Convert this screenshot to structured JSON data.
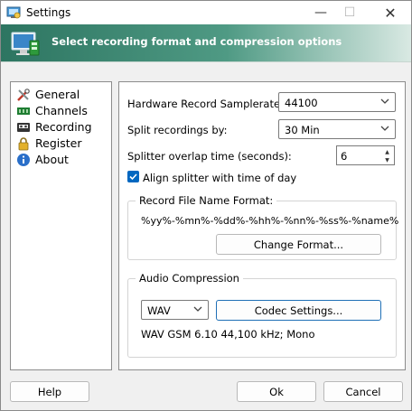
{
  "window": {
    "title": "Settings",
    "min_glyph": "—",
    "max_glyph": "☐",
    "close_glyph": "✕"
  },
  "banner": {
    "text": "Select recording format and compression options"
  },
  "sidebar": {
    "items": [
      {
        "label": "General",
        "icon": "tools-icon"
      },
      {
        "label": "Channels",
        "icon": "channels-icon"
      },
      {
        "label": "Recording",
        "icon": "tape-icon"
      },
      {
        "label": "Register",
        "icon": "lock-icon"
      },
      {
        "label": "About",
        "icon": "info-icon"
      }
    ]
  },
  "recording": {
    "samplerate_label": "Hardware Record Samplerate:",
    "samplerate_value": "44100",
    "split_label": "Split recordings by:",
    "split_value": "30 Min",
    "overlap_label": "Splitter overlap time (seconds):",
    "overlap_value": "6",
    "align_label": "Align splitter with time of day",
    "align_checked": true,
    "filename_group": "Record File Name Format:",
    "filename_format": "%yy%-%mn%-%dd%-%hh%-%nn%-%ss%-%name%",
    "change_format_btn": "Change Format...",
    "audio_group": "Audio Compression",
    "compression_value": "WAV",
    "codec_btn": "Codec Settings...",
    "codec_info": "WAV GSM 6.10  44,100 kHz; Mono"
  },
  "footer": {
    "help_label": "Help",
    "ok_label": "Ok",
    "cancel_label": "Cancel"
  },
  "colors": {
    "accent": "#0067c0",
    "banner_start": "#2d7561",
    "banner_end": "#d9e9e3"
  }
}
